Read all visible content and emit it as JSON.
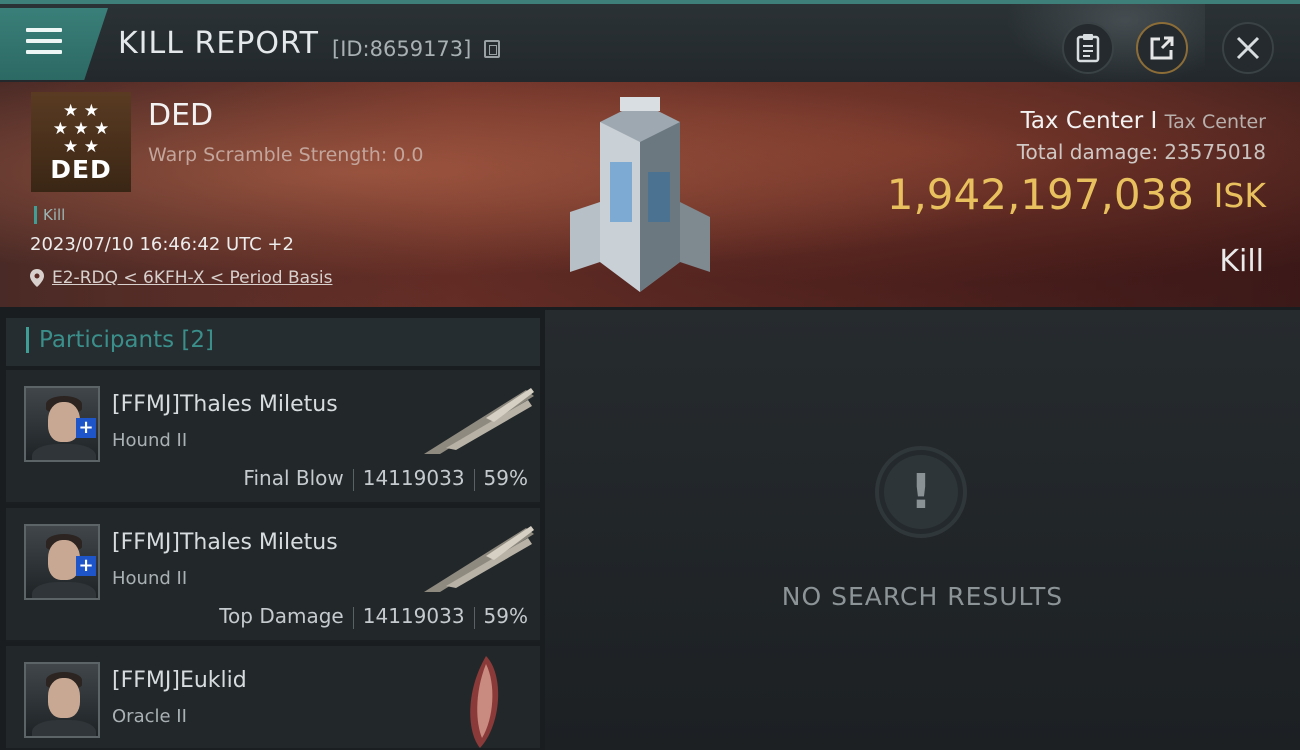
{
  "header": {
    "title": "KILL REPORT",
    "kill_id": "[ID:8659173]"
  },
  "victim": {
    "corp_logo_text": "DED",
    "name": "DED",
    "warp_scramble": "Warp Scramble Strength: 0.0",
    "tag": "Kill",
    "timestamp": "2023/07/10 16:46:42 UTC +2",
    "location": "E2-RDQ < 6KFH-X < Period Basis"
  },
  "target": {
    "name": "Tax Center I",
    "type": "Tax Center",
    "total_damage_label": "Total damage:",
    "total_damage_value": "23575018",
    "isk_value": "1,942,197,038",
    "isk_unit": "ISK",
    "result": "Kill"
  },
  "participants": {
    "title": "Participants [2]",
    "rows": [
      {
        "name": "[FFMJ]Thales Miletus",
        "ship": "Hound II",
        "role": "Final Blow",
        "damage": "14119033",
        "percent": "59%"
      },
      {
        "name": "[FFMJ]Thales Miletus",
        "ship": "Hound II",
        "role": "Top Damage",
        "damage": "14119033",
        "percent": "59%"
      },
      {
        "name": "[FFMJ]Euklid",
        "ship": "Oracle II"
      }
    ]
  },
  "results": {
    "empty_text": "NO SEARCH RESULTS"
  },
  "colors": {
    "accent": "#3f9f97",
    "isk": "#e8c05e"
  }
}
